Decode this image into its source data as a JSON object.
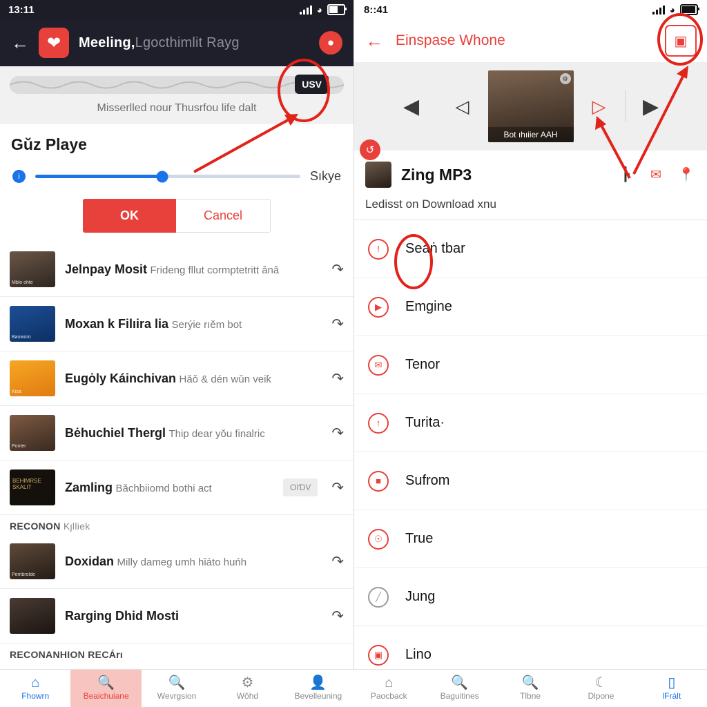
{
  "left": {
    "status": {
      "time": "13:11",
      "battery_icon": "battery-icon",
      "wifi_icon": "wifi-icon",
      "signal_icon": "signal-bars-icon"
    },
    "appbar": {
      "back_icon": "arrow-left-icon",
      "logo_icon": "heart-app-logo",
      "title": "Meeling,",
      "title_ghost": "Lgocthimlit Rayg",
      "action_icon": "panda-avatar-icon"
    },
    "wave": {
      "pill_label": "USV"
    },
    "subtitle": "Misserlled nour Thusrfou life dalt",
    "dialog": {
      "title": "Gǔz Playe",
      "slider_icon": "info-icon",
      "slider_percent": 48,
      "right_label": "Sıkye",
      "ok_label": "OK",
      "cancel_label": "Cancel"
    },
    "list": [
      {
        "title": "Jelnpay Mosit",
        "subtitle": "Frideng fllut cormptetritt ǎnǎ",
        "tag": "",
        "action_icon": "replay-icon",
        "thumb": "portrait-curly-hair",
        "thumb_label": "Mblo ohte"
      },
      {
        "title": "Moxan k Filıira lia",
        "subtitle": "Serýie rıěm bot",
        "tag": "",
        "action_icon": "replay-icon",
        "thumb": "blue-illustration",
        "thumb_label": "Baoworo"
      },
      {
        "title": "Euɡȯly Káinchivan",
        "subtitle": "Hǎǒ & dén wǔn veiƙ",
        "tag": "",
        "action_icon": "replay-icon",
        "thumb": "orange-phone",
        "thumb_label": "Kisa"
      },
      {
        "title": "Bėhuchiel Thergl",
        "subtitle": "Thip dear yǒu finalric",
        "tag": "",
        "action_icon": "replay-icon",
        "thumb": "portrait-man-brown",
        "thumb_label": "Ponter"
      },
      {
        "title": "Zamling",
        "subtitle": "Bǎchbiiomd bothi act",
        "tag": "OIƊV",
        "action_icon": "replay-icon",
        "thumb": "dark-poster",
        "thumb_label": "BEHIMRSE SKALIT"
      },
      {
        "title": "Doxidan",
        "subtitle": "Milly dameg umh hǐáto huńh",
        "tag": "",
        "action_icon": "replay-icon",
        "thumb": "portrait-young-man",
        "thumb_label": "Pembrolde"
      },
      {
        "title": "Rarging Dhid Mosti",
        "subtitle": "",
        "tag": "",
        "action_icon": "replay-icon",
        "thumb": "portrait-dim",
        "thumb_label": ""
      }
    ],
    "sections": [
      {
        "label": "RECONON",
        "suffix": "Kȷlliek"
      },
      {
        "label": "RECONANHION RECÁrı",
        "suffix": ""
      }
    ]
  },
  "right": {
    "status": {
      "time": "8::41",
      "battery_icon": "battery-icon",
      "wifi_icon": "wifi-icon",
      "signal_icon": "signal-bars-icon"
    },
    "appbar": {
      "back_icon": "arrow-left-icon",
      "title": "Einspase Whone",
      "action_icon": "archive-box-icon"
    },
    "player": {
      "prev_icon": "play-left-filled-icon",
      "prev_outline_icon": "play-left-outline-icon",
      "next_outline_icon": "play-right-outline-icon",
      "next_icon": "play-right-filled-icon",
      "video_caption": "Bot ıhıiier AAH",
      "video_badge_icon": "gear-badge-icon",
      "refresh_icon": "refresh-icon"
    },
    "head": {
      "avatar_icon": "user-avatar",
      "title": "Zing MP3",
      "icons": [
        "pause-bars-icon",
        "mail-circle-icon",
        "location-pin-icon"
      ],
      "subtitle": "Ledisst on Download xnu"
    },
    "rows": [
      {
        "label": "Seaṅ tbar",
        "icon": "exclamation-circle-icon",
        "highlighted": true
      },
      {
        "label": "Emgine",
        "icon": "play-circle-icon",
        "highlighted": false
      },
      {
        "label": "Tenor",
        "icon": "mail-circle-icon",
        "highlighted": false
      },
      {
        "label": "Turita·",
        "icon": "arrow-up-circle-icon",
        "highlighted": false
      },
      {
        "label": "Sufrom",
        "icon": "bag-circle-icon",
        "highlighted": false
      },
      {
        "label": "True",
        "icon": "spiral-circle-icon",
        "highlighted": false
      },
      {
        "label": "Jung",
        "icon": "no-entry-circle-icon",
        "highlighted": false
      },
      {
        "label": "Lino",
        "icon": "card-circle-icon",
        "highlighted": false
      }
    ]
  },
  "bottom_nav": [
    {
      "label": "Fhowrn",
      "icon": "home-icon",
      "state": "active"
    },
    {
      "label": "Beaichuiane",
      "icon": "search-icon",
      "state": "highlight"
    },
    {
      "label": "Wevrgsion",
      "icon": "search-icon",
      "state": "normal"
    },
    {
      "label": "Wǒhd",
      "icon": "gear-icon",
      "state": "normal"
    },
    {
      "label": "Bevelleuning",
      "icon": "person-icon",
      "state": "normal"
    },
    {
      "label": "Paocback",
      "icon": "home-icon",
      "state": "normal"
    },
    {
      "label": "Baguitines",
      "icon": "search-icon",
      "state": "normal"
    },
    {
      "label": "Tlbne",
      "icon": "search-icon",
      "state": "normal"
    },
    {
      "label": "Dlpone",
      "icon": "moon-circle-icon",
      "state": "normal"
    },
    {
      "label": "lFrált",
      "icon": "monitor-icon",
      "state": "active"
    }
  ],
  "annotations": {
    "accent": "#e2231a",
    "ellipses": [
      "usv-pill-ellipse",
      "right-appbar-button-ellipse",
      "sean-tbar-ellipse"
    ],
    "arrows": [
      "arrow-to-usv-pill",
      "arrow-to-play-right-outline",
      "arrow-to-archive-button"
    ]
  }
}
